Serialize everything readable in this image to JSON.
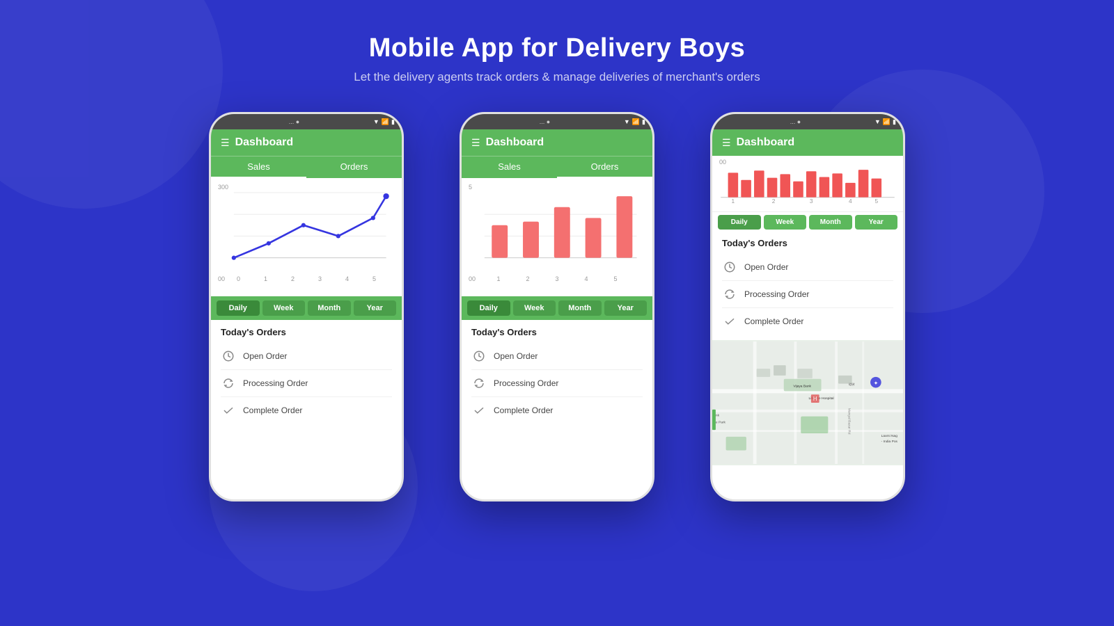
{
  "header": {
    "title": "Mobile App for Delivery Boys",
    "subtitle": "Let the delivery agents track orders & manage deliveries of merchant's orders"
  },
  "phones": [
    {
      "id": "phone1",
      "statusBar": "... ●",
      "headerTitle": "Dashboard",
      "tabs": [
        "Sales",
        "Orders"
      ],
      "activeTab": "Sales",
      "chartType": "line",
      "chartYMax": "300",
      "chartYMin": "00",
      "chartXLabels": [
        "0",
        "1",
        "2",
        "3",
        "4",
        "5"
      ],
      "periodButtons": [
        "Daily",
        "Week",
        "Month",
        "Year"
      ],
      "activePeriod": "Daily",
      "ordersTitle": "Today's Orders",
      "orderItems": [
        {
          "icon": "clock",
          "label": "Open Order"
        },
        {
          "icon": "refresh",
          "label": "Processing Order"
        },
        {
          "icon": "check",
          "label": "Complete Order"
        }
      ]
    },
    {
      "id": "phone2",
      "statusBar": "... ●",
      "headerTitle": "Dashboard",
      "tabs": [
        "Sales",
        "Orders"
      ],
      "activeTab": "Orders",
      "chartType": "bar",
      "chartYMax": "5",
      "chartYMin": "00",
      "chartXLabels": [
        "1",
        "2",
        "3",
        "4",
        "5"
      ],
      "periodButtons": [
        "Daily",
        "Week",
        "Month",
        "Year"
      ],
      "activePeriod": "Daily",
      "ordersTitle": "Today's Orders",
      "orderItems": [
        {
          "icon": "clock",
          "label": "Open Order"
        },
        {
          "icon": "refresh",
          "label": "Processing Order"
        },
        {
          "icon": "check",
          "label": "Complete Order"
        }
      ]
    },
    {
      "id": "phone3",
      "statusBar": "... ●",
      "headerTitle": "Dashboard",
      "chartType": "bar-small",
      "chartYMax": "00",
      "chartXLabels": [
        "1",
        "2",
        "3",
        "4",
        "5"
      ],
      "periodButtons": [
        "Daily",
        "Week",
        "Month",
        "Year"
      ],
      "activePeriod": "Daily",
      "ordersTitle": "Today's Orders",
      "orderItems": [
        {
          "icon": "clock",
          "label": "Open Order"
        },
        {
          "icon": "refresh",
          "label": "Processing Order"
        },
        {
          "icon": "check",
          "label": "Complete Order"
        }
      ]
    }
  ],
  "colors": {
    "green": "#5cb85c",
    "greenDark": "#4a9e4a",
    "blueLine": "#3535e0",
    "barRed": "#f47070",
    "barRedSmall": "#e05555",
    "background": "#2d34c8",
    "white": "#ffffff"
  }
}
